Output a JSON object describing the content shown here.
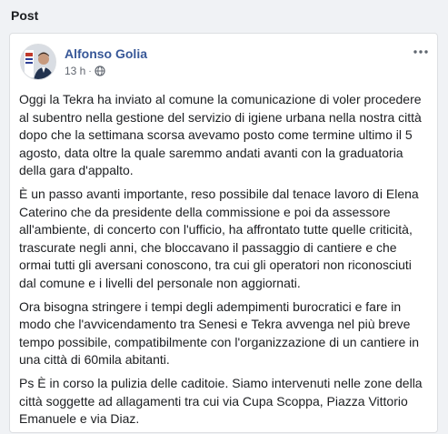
{
  "section": {
    "title": "Post"
  },
  "post": {
    "author": "Alfonso Golia",
    "timestamp": "13 h",
    "separator": "·",
    "privacy_icon": "globe-icon",
    "more_icon": "more-options-icon",
    "paragraphs": [
      "Oggi la Tekra ha inviato al comune la comunicazione di voler procedere al subentro nella gestione del servizio di igiene urbana nella nostra città dopo che la settimana scorsa avevamo posto come termine ultimo il 5 agosto, data oltre la quale saremmo andati avanti con la graduatoria della gara d'appalto.",
      "È un passo avanti importante, reso possibile dal tenace lavoro di Elena Caterino che da presidente della commissione e poi da assessore all'ambiente, di concerto con l'ufficio, ha affrontato tutte quelle criticità, trascurate negli anni, che bloccavano il passaggio di cantiere e che ormai tutti gli aversani conoscono, tra cui gli operatori non riconosciuti dal comune e i livelli del personale non aggiornati.",
      "Ora bisogna stringere i tempi degli adempimenti burocratici e fare in modo che l'avvicendamento tra Senesi e Tekra avvenga nel più breve tempo possibile, compatibilmente con l'organizzazione di un cantiere in una città di 60mila abitanti.",
      "Ps È in corso la pulizia delle caditoie. Siamo intervenuti nelle zone della città soggette ad allagamenti tra cui via Cupa Scoppa, Piazza Vittorio Emanuele e via Diaz."
    ]
  },
  "colors": {
    "author_link": "#385898",
    "meta_text": "#616770",
    "page_bg": "#f0f2f5",
    "card_border": "#dddfe2"
  }
}
